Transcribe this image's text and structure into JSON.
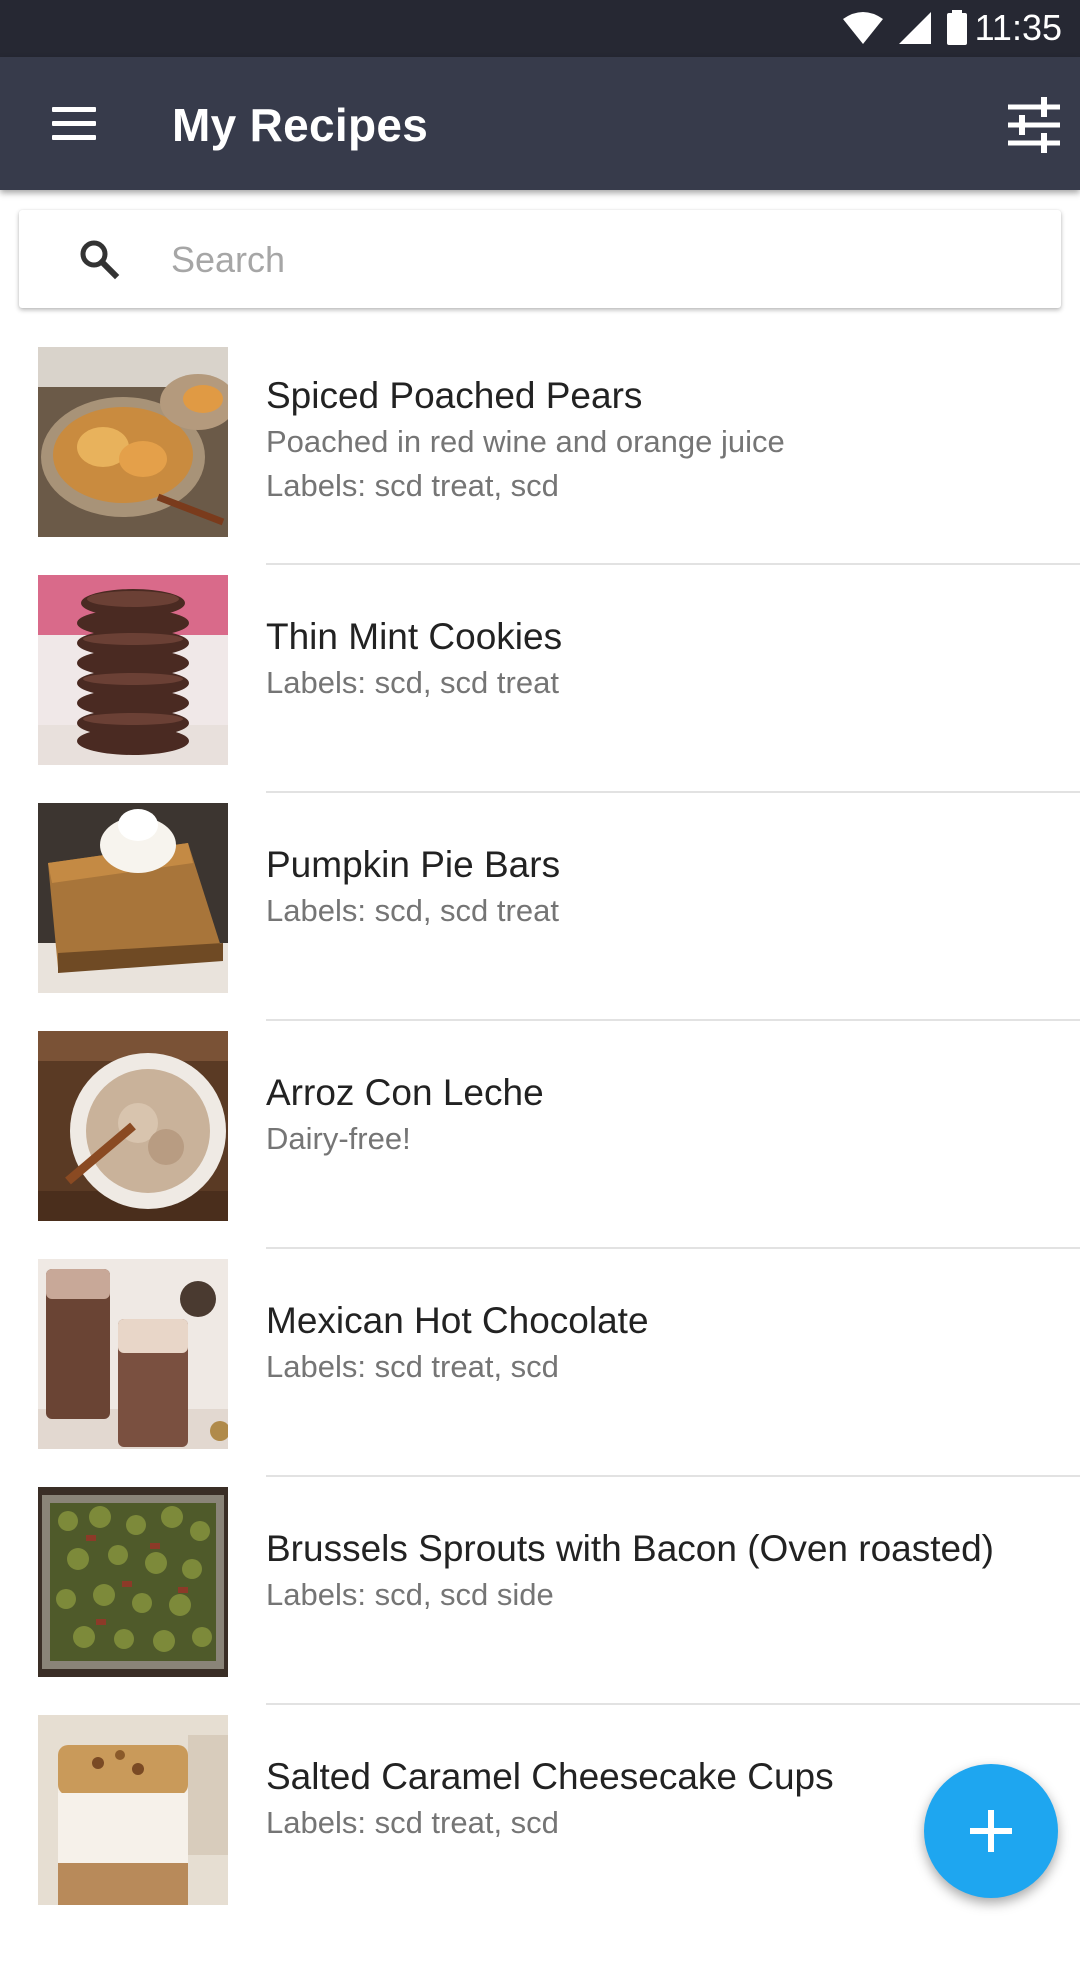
{
  "status_bar": {
    "time": "11:35",
    "icons": [
      "wifi-icon",
      "cell-signal-icon",
      "battery-icon"
    ]
  },
  "app_bar": {
    "title": "My Recipes",
    "menu_icon": "menu-icon",
    "filter_icon": "tune-icon"
  },
  "search": {
    "placeholder": "Search",
    "icon": "search-icon"
  },
  "recipes": [
    {
      "title": "Spiced Poached Pears",
      "description": "Poached in red wine and orange juice",
      "labels": "Labels: scd treat, scd"
    },
    {
      "title": "Thin Mint Cookies",
      "labels": "Labels: scd, scd treat"
    },
    {
      "title": "Pumpkin Pie Bars",
      "labels": "Labels: scd, scd treat"
    },
    {
      "title": "Arroz Con Leche",
      "description": "Dairy-free!"
    },
    {
      "title": "Mexican Hot Chocolate",
      "labels": "Labels: scd treat, scd"
    },
    {
      "title": "Brussels Sprouts with Bacon (Oven roasted)",
      "labels": "Labels: scd, scd side"
    },
    {
      "title": "Salted Caramel Cheesecake Cups",
      "labels": "Labels: scd treat, scd"
    }
  ],
  "fab": {
    "icon": "add-icon"
  },
  "colors": {
    "status_bar": "#262833",
    "app_bar": "#373b4b",
    "fab": "#1ea6f0",
    "title_text": "#222222",
    "secondary_text": "#757575"
  }
}
